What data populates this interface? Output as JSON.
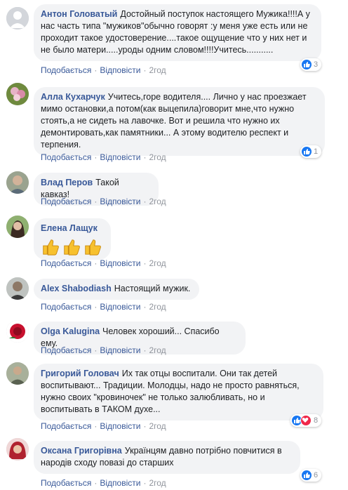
{
  "comments": [
    {
      "author": "Антон Головатый",
      "text": "Достойный поступок настоящего Мужика!!!!А у нас часть типа \"мужиков\"обычно говорят :у меня уже есть или не проходит такое удостоверение....такое ощущение что у них нет и не было матери.....уроды одним словом!!!!Учитесь...........",
      "like": "Подобається",
      "reply": "Відповісти",
      "time": "2год",
      "reactions": "3"
    },
    {
      "author": "Алла Кухарчук",
      "text": "Учитесь,горе водителя.... Лично у нас проезжает мимо остановки,а потом(как выцепила)говорит мне,что нужно стоять,а не сидеть на лавочке. Вот и решила что нужно их демонтировать,как памятники... А этому водителю респект и терпения.",
      "like": "Подобається",
      "reply": "Відповісти",
      "time": "2год",
      "reactions": "1"
    },
    {
      "author": "Влад Перов",
      "text": "Такой кавказ!",
      "like": "Подобається",
      "reply": "Відповісти",
      "time": "2год"
    },
    {
      "author": "Елена Лащук",
      "text": "",
      "like": "Подобається",
      "reply": "Відповісти",
      "time": "2год"
    },
    {
      "author": "Alex Shabodiash",
      "text": "Настоящий мужик.",
      "like": "Подобається",
      "reply": "Відповісти",
      "time": "2год"
    },
    {
      "author": "Olga Kalugina",
      "text": "Человек хороший... Спасибо ему.",
      "like": "Подобається",
      "reply": "Відповісти",
      "time": "2год"
    },
    {
      "author": "Григорий Головач",
      "text": "Их так отцы воспитали. Они так детей воспитывают... Традиции. Молодцы, надо не просто равняться, нужно своих \"кровиночек\" не только залюбливать, но и воспитывать в ТАКОМ духе...",
      "like": "Подобається",
      "reply": "Відповісти",
      "time": "2год",
      "reactions": "8"
    },
    {
      "author": "Оксана Григорівна",
      "text": "Українцям давно потрібно повчитися в народів сходу повазі до старших",
      "like": "Подобається",
      "reply": "Відповісти",
      "time": "2год",
      "reactions": "6"
    }
  ],
  "colors": {
    "link": "#385898",
    "bubble": "#f2f3f5",
    "like": "#1877f2",
    "love": "#f0284a"
  }
}
